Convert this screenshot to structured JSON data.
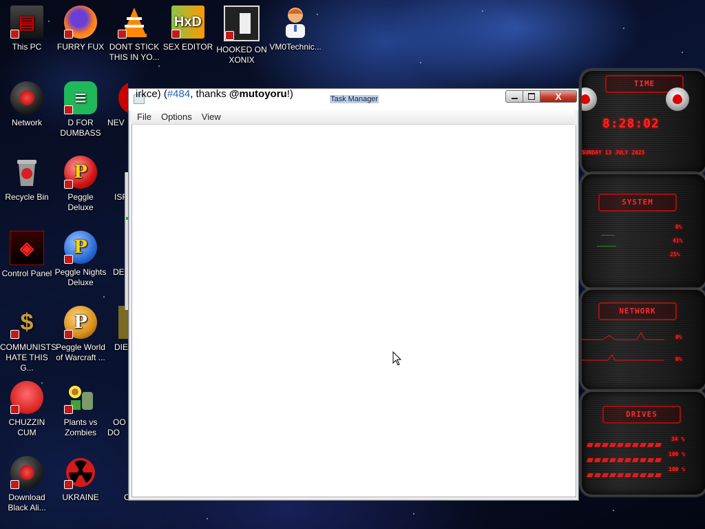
{
  "desktop": {
    "icons": [
      {
        "label": "This PC",
        "glyph": "pc-icon"
      },
      {
        "label": "FURRY FUX",
        "glyph": "firefox-icon"
      },
      {
        "label": "DONT STICK THIS IN YO...",
        "glyph": "vlc-icon"
      },
      {
        "label": "SEX EDITOR",
        "glyph": "hxd-icon"
      },
      {
        "label": "HOOKED ON XONIX",
        "glyph": "xonix-icon"
      },
      {
        "label": "VM0Technic...",
        "glyph": "doctor-icon"
      },
      {
        "label": "Network",
        "glyph": "network-icon"
      },
      {
        "label": "D FOR DUMBASS",
        "glyph": "discord-icon"
      },
      {
        "label": "NEV",
        "glyph": "app-icon"
      },
      {
        "label": "Recycle Bin",
        "glyph": "recycle-bin-icon"
      },
      {
        "label": "Peggle Deluxe",
        "glyph": "peggle-icon"
      },
      {
        "label": "ISR",
        "glyph": "app-icon"
      },
      {
        "label": "Control Panel",
        "glyph": "control-panel-icon"
      },
      {
        "label": "Peggle Nights Deluxe",
        "glyph": "peggle-nights-icon"
      },
      {
        "label": "DEB",
        "glyph": "app-icon"
      },
      {
        "label": "COMMUNISTS HATE THIS G...",
        "glyph": "money-bag-icon"
      },
      {
        "label": "Peggle World of Warcraft ...",
        "glyph": "peggle-wow-icon"
      },
      {
        "label": "DIE",
        "glyph": "app-icon"
      },
      {
        "label": "CHUZZIN CUM",
        "glyph": "chuzzle-icon"
      },
      {
        "label": "Plants vs Zombies",
        "glyph": "pvz-icon"
      },
      {
        "label": "OO DO",
        "glyph": "app-icon"
      },
      {
        "label": "Download Black Ali...",
        "glyph": "alienware-icon"
      },
      {
        "label": "UKRAINE",
        "glyph": "radiation-icon"
      },
      {
        "label": "C",
        "glyph": "app-icon"
      }
    ]
  },
  "task_manager": {
    "title": "Task Manager",
    "overlap_text": {
      "prefix": "irkce) (",
      "link": "#484",
      "mid": ", thanks ",
      "bold": "@mutoyoru",
      "suffix": "!)"
    },
    "menu": [
      "File",
      "Options",
      "View"
    ],
    "close_glyph": "X"
  },
  "widget": {
    "time_header": "TIME",
    "clock": "8:28:02",
    "date": "SUNDAY 13 JULY 2025",
    "system_header": "SYSTEM",
    "system_values": [
      "0%",
      "41%",
      "25%"
    ],
    "network_header": "NETWORK",
    "network_values": [
      "0%",
      "0%"
    ],
    "drives_header": "DRIVES",
    "drive_values": [
      "34 %",
      "100 %",
      "100 %"
    ]
  }
}
